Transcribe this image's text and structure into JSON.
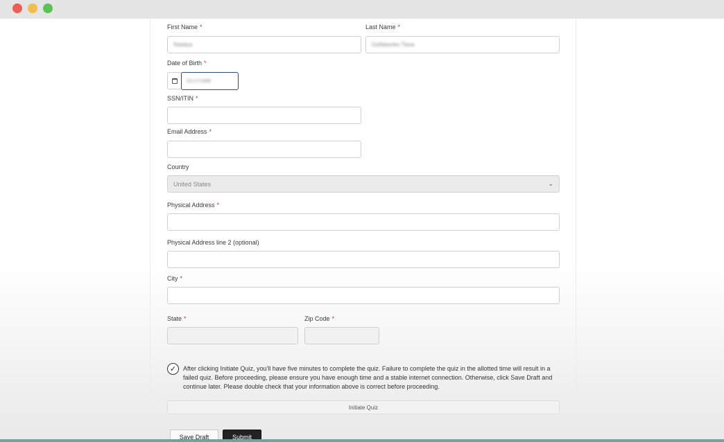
{
  "fields": {
    "first_name": {
      "label": "First Name",
      "value": "Natalya"
    },
    "last_name": {
      "label": "Last Name",
      "value": "Gelfakenko Tissa"
    },
    "dob": {
      "label": "Date of Birth",
      "value": "01/17/1999"
    },
    "ssn": {
      "label": "SSN/ITIN",
      "value": ""
    },
    "email": {
      "label": "Email Address",
      "value": ""
    },
    "country": {
      "label": "Country",
      "value": "United States"
    },
    "address1": {
      "label": "Physical Address",
      "value": ""
    },
    "address2": {
      "label": "Physical Address line 2 (optional)",
      "value": ""
    },
    "city": {
      "label": "City",
      "value": ""
    },
    "state": {
      "label": "State",
      "value": ""
    },
    "zip": {
      "label": "Zip Code",
      "value": ""
    }
  },
  "required_mark": "*",
  "notice": "After clicking Initiate Quiz, you'll have five minutes to complete the quiz. Failure to complete the quiz in the allotted time will result in a failed quiz. Before proceeding, please ensure you have enough time and a stable internet connection. Otherwise, click Save Draft and continue later. Please double check that your information above is correct before proceeding.",
  "buttons": {
    "initiate_quiz": "Initiate Quiz",
    "save_draft": "Save Draft",
    "submit": "Submit"
  },
  "icons": {
    "checkmark": "✓",
    "chevron": "⌄"
  },
  "colors": {
    "required": "#c0392b",
    "submit_bg": "#222222",
    "focus_border": "#2b4a7a"
  }
}
